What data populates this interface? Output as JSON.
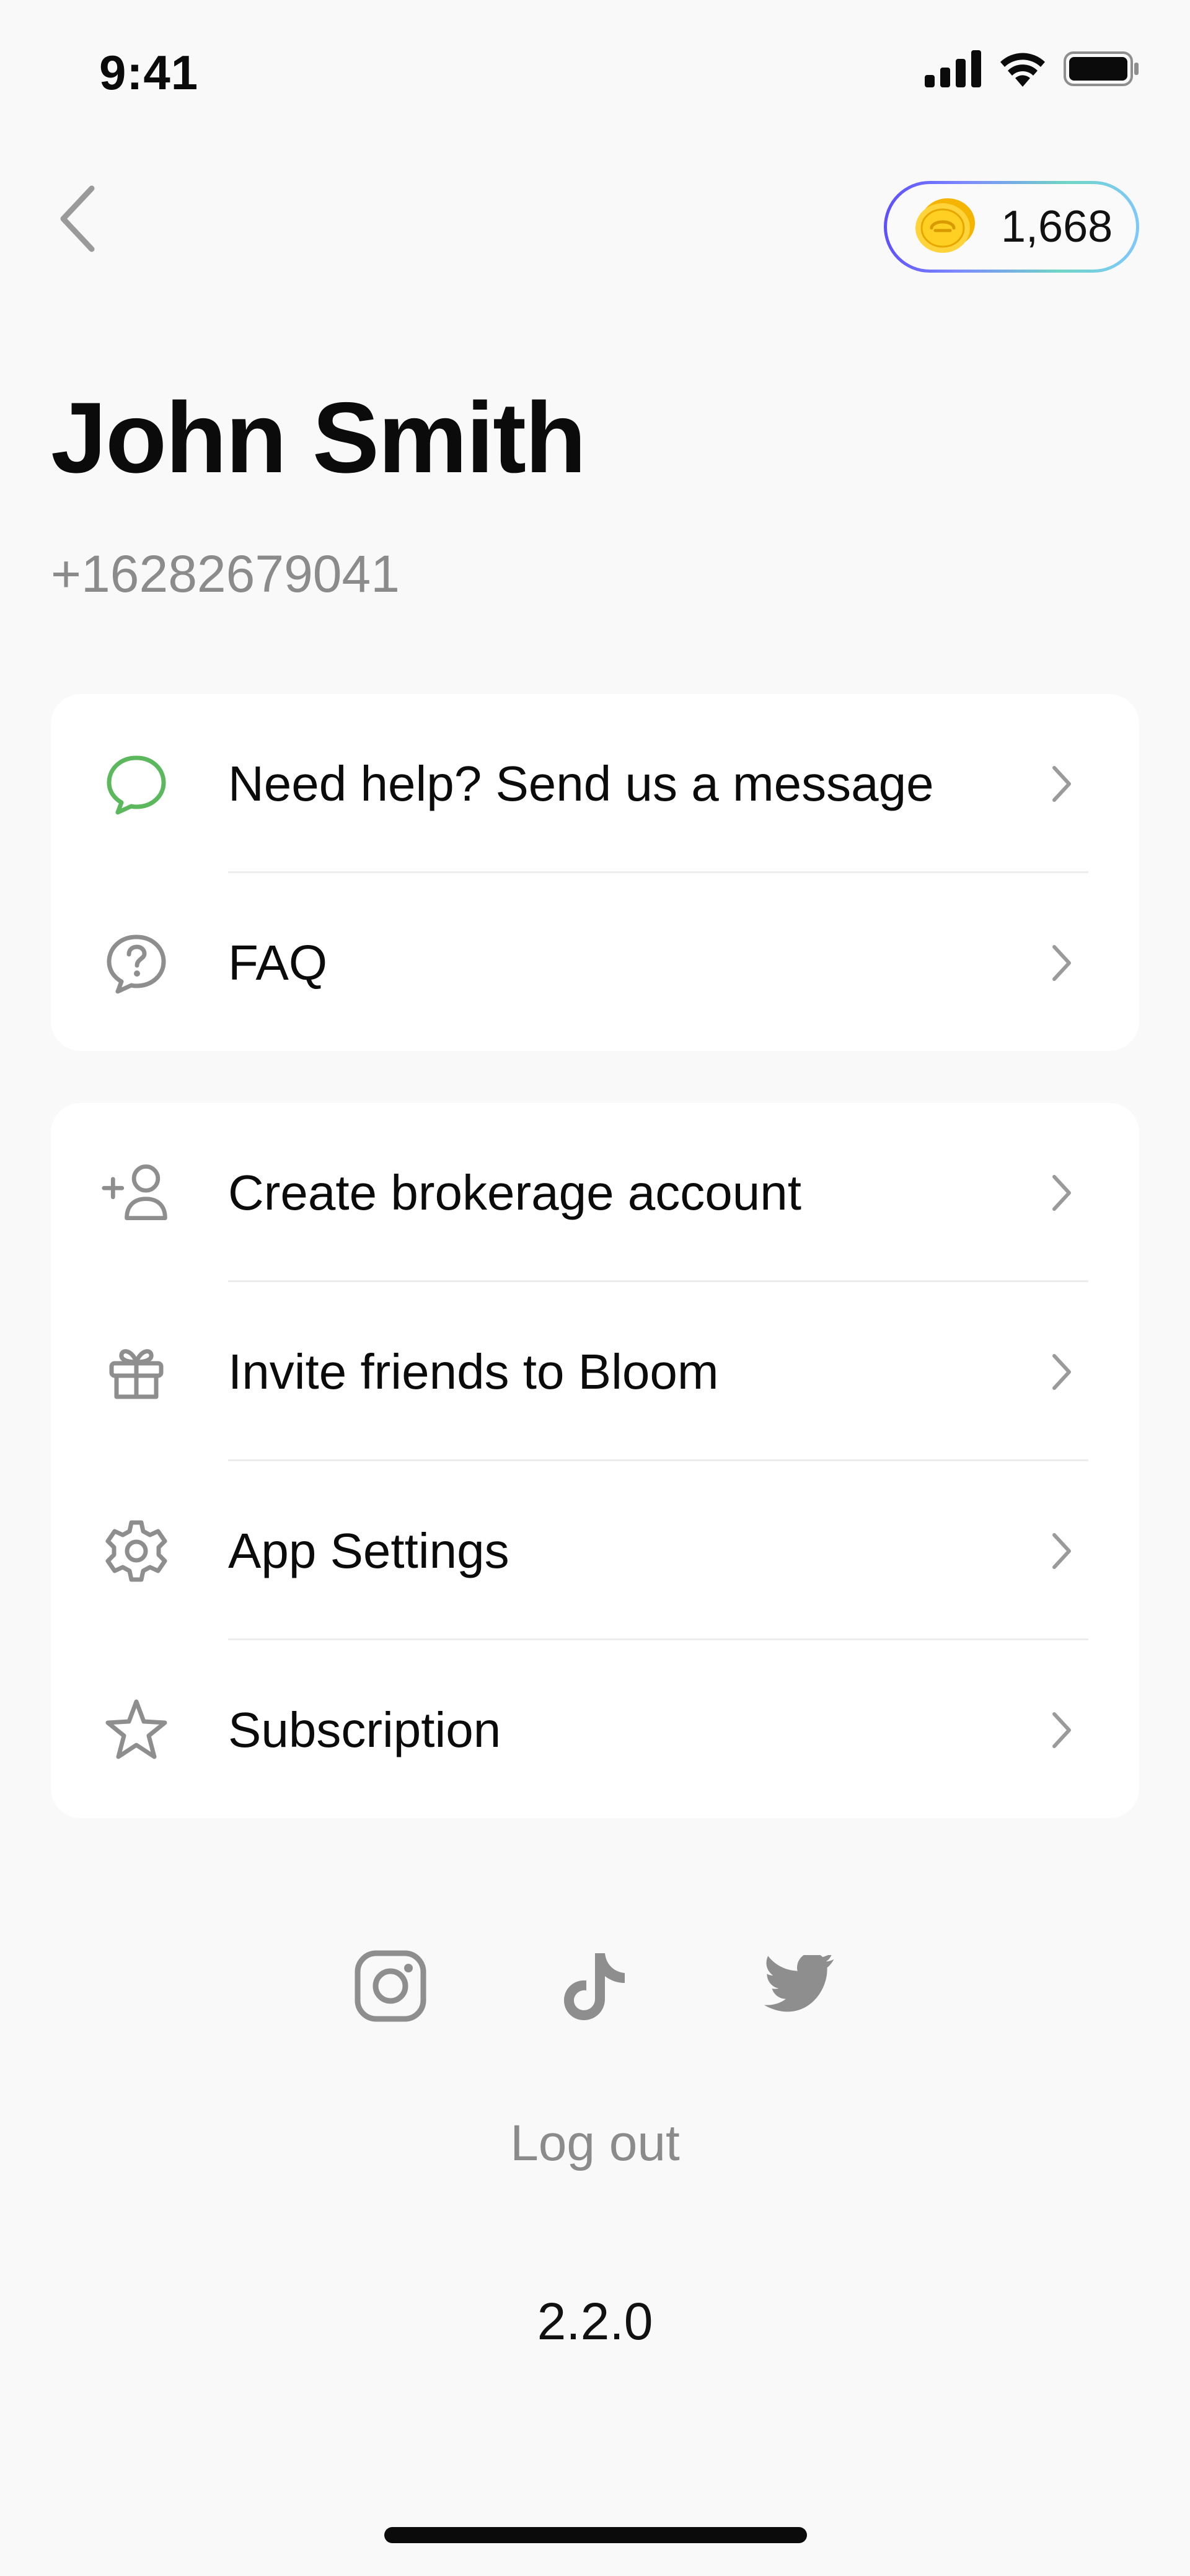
{
  "status_bar": {
    "time": "9:41",
    "icons": [
      "cellular-signal-icon",
      "wifi-icon",
      "battery-icon"
    ]
  },
  "header": {
    "back_icon": "chevron-left-icon",
    "coins": {
      "icon": "coin-icon",
      "value": "1,668"
    }
  },
  "profile": {
    "name": "John Smith",
    "phone": "+16282679041"
  },
  "support_card": {
    "items": [
      {
        "label": "Need help? Send us a message",
        "icon": "message-bubble-icon"
      },
      {
        "label": "FAQ",
        "icon": "question-bubble-icon"
      }
    ]
  },
  "account_card": {
    "items": [
      {
        "label": "Create brokerage account",
        "icon": "add-user-icon"
      },
      {
        "label": "Invite friends to Bloom",
        "icon": "gift-icon"
      },
      {
        "label": "App Settings",
        "icon": "gear-icon"
      },
      {
        "label": "Subscription",
        "icon": "star-icon"
      }
    ]
  },
  "social": [
    "instagram-icon",
    "tiktok-icon",
    "twitter-icon"
  ],
  "footer": {
    "logout_label": "Log out",
    "version": "2.2.0"
  },
  "colors": {
    "background": "#f9f9f9",
    "card": "#ffffff",
    "accent_green": "#5cb85c",
    "muted": "#8b8b8b",
    "icon_gray": "#8e8e8e",
    "coin_yellow": "#f5c518"
  }
}
